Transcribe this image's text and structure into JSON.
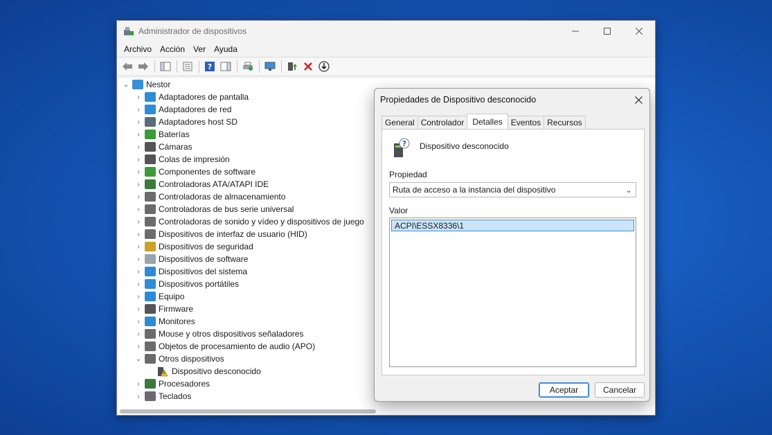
{
  "window": {
    "title": "Administrador de dispositivos",
    "controls": [
      "minimize",
      "maximize",
      "close"
    ]
  },
  "menu": [
    "Archivo",
    "Acción",
    "Ver",
    "Ayuda"
  ],
  "tree": {
    "root": "Nestor",
    "categories": [
      {
        "label": "Adaptadores de pantalla",
        "icon": "monitor-icon",
        "color": "#2e8bd6"
      },
      {
        "label": "Adaptadores de red",
        "icon": "network-icon",
        "color": "#2e8bd6"
      },
      {
        "label": "Adaptadores host SD",
        "icon": "sd-host-icon",
        "color": "#5c6b7a"
      },
      {
        "label": "Baterías",
        "icon": "battery-icon",
        "color": "#3a9b3a"
      },
      {
        "label": "Cámaras",
        "icon": "camera-icon",
        "color": "#555555"
      },
      {
        "label": "Colas de impresión",
        "icon": "printer-icon",
        "color": "#555555"
      },
      {
        "label": "Componentes de software",
        "icon": "software-component-icon",
        "color": "#3a9b3a"
      },
      {
        "label": "Controladoras ATA/ATAPI IDE",
        "icon": "ide-controller-icon",
        "color": "#3a7a3a"
      },
      {
        "label": "Controladoras de almacenamiento",
        "icon": "storage-controller-icon",
        "color": "#6b6b6b"
      },
      {
        "label": "Controladoras de bus serie universal",
        "icon": "usb-icon",
        "color": "#6b6b6b"
      },
      {
        "label": "Controladoras de sonido y vídeo y dispositivos de juego",
        "icon": "speaker-icon",
        "color": "#6b6b6b"
      },
      {
        "label": "Dispositivos de interfaz de usuario (HID)",
        "icon": "hid-icon",
        "color": "#6b6b6b"
      },
      {
        "label": "Dispositivos de seguridad",
        "icon": "security-device-icon",
        "color": "#c9a227"
      },
      {
        "label": "Dispositivos de software",
        "icon": "software-device-icon",
        "color": "#9aa4ad"
      },
      {
        "label": "Dispositivos del sistema",
        "icon": "system-device-icon",
        "color": "#2e8bd6"
      },
      {
        "label": "Dispositivos portátiles",
        "icon": "portable-device-icon",
        "color": "#2e8bd6"
      },
      {
        "label": "Equipo",
        "icon": "computer-icon",
        "color": "#2e8bd6"
      },
      {
        "label": "Firmware",
        "icon": "firmware-icon",
        "color": "#555555"
      },
      {
        "label": "Monitores",
        "icon": "monitor-icon",
        "color": "#2e8bd6"
      },
      {
        "label": "Mouse y otros dispositivos señaladores",
        "icon": "mouse-icon",
        "color": "#6b6b6b"
      },
      {
        "label": "Objetos de procesamiento de audio (APO)",
        "icon": "audio-apo-icon",
        "color": "#6b6b6b"
      },
      {
        "label": "Otros dispositivos",
        "icon": "unknown-device-icon",
        "color": "#6b6b6b",
        "expanded": true,
        "children": [
          {
            "label": "Dispositivo desconocido",
            "icon": "warning-device-icon"
          }
        ]
      },
      {
        "label": "Procesadores",
        "icon": "processor-icon",
        "color": "#3a7a3a"
      },
      {
        "label": "Teclados",
        "icon": "keyboard-icon",
        "color": "#6b6b6b"
      }
    ]
  },
  "dialog": {
    "title": "Propiedades de Dispositivo desconocido",
    "tabs": [
      "General",
      "Controlador",
      "Detalles",
      "Eventos",
      "Recursos"
    ],
    "active_tab": "Detalles",
    "device_name": "Dispositivo desconocido",
    "property_label": "Propiedad",
    "property_value": "Ruta de acceso a la instancia del dispositivo",
    "value_label": "Valor",
    "values": [
      "ACPI\\ESSX8336\\1"
    ],
    "ok_label": "Aceptar",
    "cancel_label": "Cancelar"
  }
}
